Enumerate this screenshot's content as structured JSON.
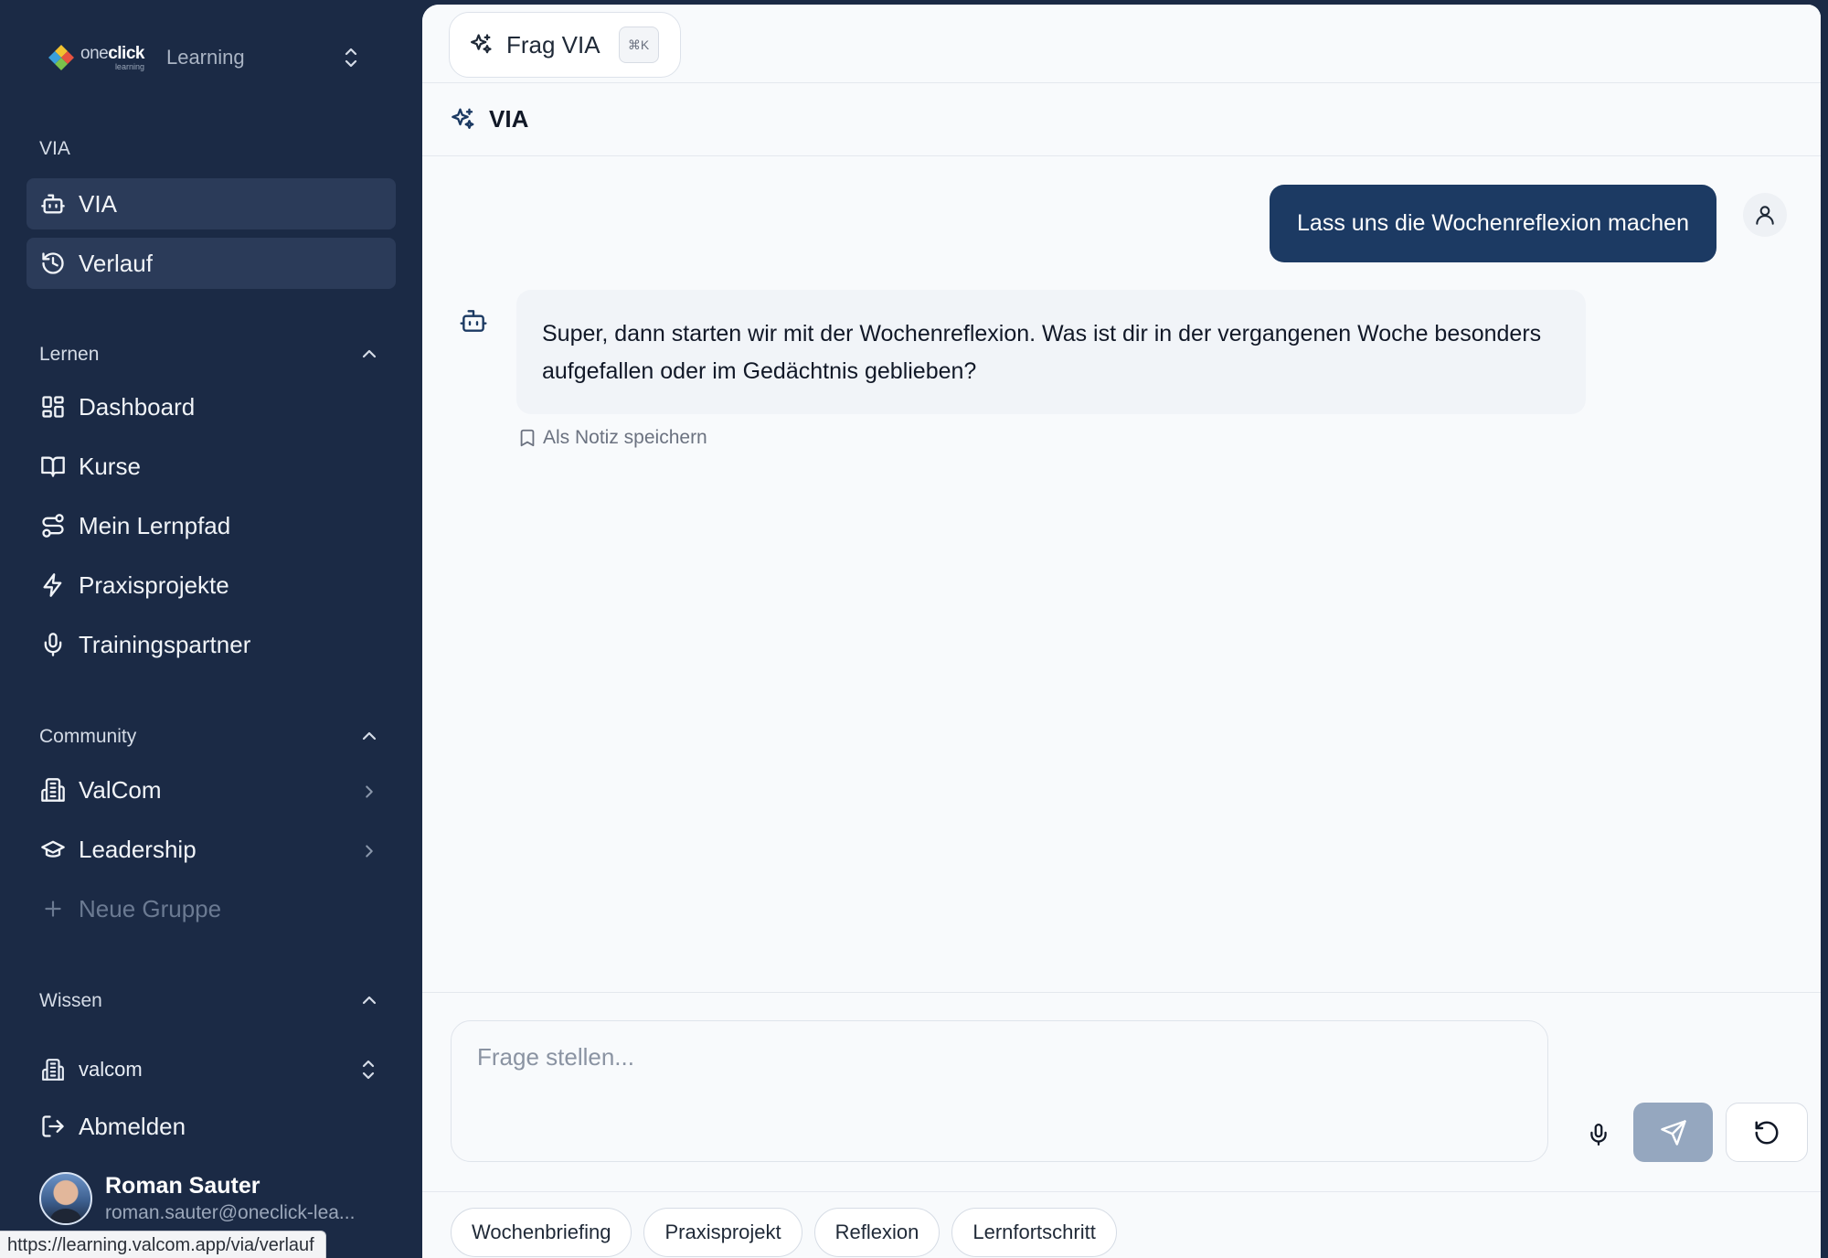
{
  "colors": {
    "sidebar_bg": "#1b2a45",
    "active_item": "#2b3b59",
    "user_bubble": "#1c3a63",
    "send_button": "#95a7bf"
  },
  "brand": {
    "logo_word_light": "one",
    "logo_word_bold": "click",
    "logo_small": "learning",
    "product": "Learning"
  },
  "sidebar": {
    "via_section": {
      "label": "VIA",
      "items": [
        {
          "label": "VIA",
          "icon": "bot-icon"
        },
        {
          "label": "Verlauf",
          "icon": "history-icon"
        }
      ]
    },
    "lernen_section": {
      "label": "Lernen",
      "items": [
        {
          "label": "Dashboard",
          "icon": "dashboard-icon"
        },
        {
          "label": "Kurse",
          "icon": "book-icon"
        },
        {
          "label": "Mein Lernpfad",
          "icon": "route-icon"
        },
        {
          "label": "Praxisprojekte",
          "icon": "bolt-icon"
        },
        {
          "label": "Trainingspartner",
          "icon": "mic-icon"
        }
      ]
    },
    "community_section": {
      "label": "Community",
      "items": [
        {
          "label": "ValCom",
          "icon": "building-icon"
        },
        {
          "label": "Leadership",
          "icon": "graduation-cap-icon"
        },
        {
          "label": "Neue Gruppe",
          "icon": "plus-icon"
        }
      ]
    },
    "wissen_section": {
      "label": "Wissen"
    },
    "workspace": {
      "label": "valcom",
      "icon": "building-icon"
    },
    "logout": {
      "label": "Abmelden",
      "icon": "logout-icon"
    },
    "user": {
      "name": "Roman Sauter",
      "email": "roman.sauter@oneclick-lea..."
    }
  },
  "status_bar": {
    "url": "https://learning.valcom.app/via/verlauf"
  },
  "topbar": {
    "frag_label": "Frag VIA",
    "shortcut": "⌘K"
  },
  "chat": {
    "title": "VIA",
    "user_message": "Lass uns die Wochenreflexion machen",
    "bot_message": "Super, dann starten wir mit der Wochenreflexion. Was ist dir in der vergangenen Woche besonders aufgefallen oder im Gedächtnis geblieben?",
    "save_note": "Als Notiz speichern"
  },
  "composer": {
    "placeholder": "Frage stellen...",
    "value": ""
  },
  "suggestions": [
    "Wochenbriefing",
    "Praxisprojekt",
    "Reflexion",
    "Lernfortschritt"
  ]
}
